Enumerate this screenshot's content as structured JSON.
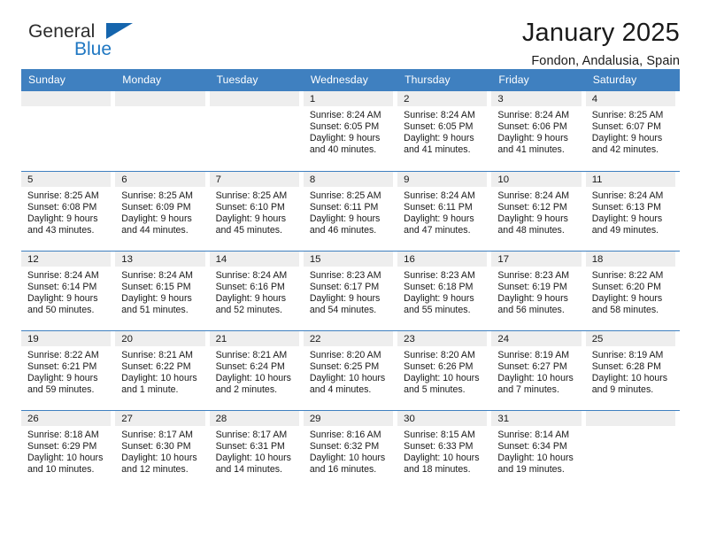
{
  "brand": {
    "word_one": "General",
    "word_two": "Blue",
    "triangle_color": "#1565ad",
    "blue_text_color": "#1f77c2"
  },
  "header": {
    "title": "January 2025",
    "subtitle": "Fondon, Andalusia, Spain",
    "header_bg": "#3f80c0",
    "header_text": "#ffffff"
  },
  "labels": {
    "sunrise_prefix": "Sunrise:",
    "sunset_prefix": "Sunset:",
    "daylight_prefix": "Daylight:"
  },
  "columns": [
    "Sunday",
    "Monday",
    "Tuesday",
    "Wednesday",
    "Thursday",
    "Friday",
    "Saturday"
  ],
  "weeks": [
    [
      {
        "day": "",
        "empty": true,
        "lines": []
      },
      {
        "day": "",
        "empty": true,
        "lines": []
      },
      {
        "day": "",
        "empty": true,
        "lines": []
      },
      {
        "day": "1",
        "empty": false,
        "lines": [
          "Sunrise: 8:24 AM",
          "Sunset: 6:05 PM",
          "Daylight: 9 hours",
          "and 40 minutes."
        ]
      },
      {
        "day": "2",
        "empty": false,
        "lines": [
          "Sunrise: 8:24 AM",
          "Sunset: 6:05 PM",
          "Daylight: 9 hours",
          "and 41 minutes."
        ]
      },
      {
        "day": "3",
        "empty": false,
        "lines": [
          "Sunrise: 8:24 AM",
          "Sunset: 6:06 PM",
          "Daylight: 9 hours",
          "and 41 minutes."
        ]
      },
      {
        "day": "4",
        "empty": false,
        "lines": [
          "Sunrise: 8:25 AM",
          "Sunset: 6:07 PM",
          "Daylight: 9 hours",
          "and 42 minutes."
        ]
      }
    ],
    [
      {
        "day": "5",
        "empty": false,
        "lines": [
          "Sunrise: 8:25 AM",
          "Sunset: 6:08 PM",
          "Daylight: 9 hours",
          "and 43 minutes."
        ]
      },
      {
        "day": "6",
        "empty": false,
        "lines": [
          "Sunrise: 8:25 AM",
          "Sunset: 6:09 PM",
          "Daylight: 9 hours",
          "and 44 minutes."
        ]
      },
      {
        "day": "7",
        "empty": false,
        "lines": [
          "Sunrise: 8:25 AM",
          "Sunset: 6:10 PM",
          "Daylight: 9 hours",
          "and 45 minutes."
        ]
      },
      {
        "day": "8",
        "empty": false,
        "lines": [
          "Sunrise: 8:25 AM",
          "Sunset: 6:11 PM",
          "Daylight: 9 hours",
          "and 46 minutes."
        ]
      },
      {
        "day": "9",
        "empty": false,
        "lines": [
          "Sunrise: 8:24 AM",
          "Sunset: 6:11 PM",
          "Daylight: 9 hours",
          "and 47 minutes."
        ]
      },
      {
        "day": "10",
        "empty": false,
        "lines": [
          "Sunrise: 8:24 AM",
          "Sunset: 6:12 PM",
          "Daylight: 9 hours",
          "and 48 minutes."
        ]
      },
      {
        "day": "11",
        "empty": false,
        "lines": [
          "Sunrise: 8:24 AM",
          "Sunset: 6:13 PM",
          "Daylight: 9 hours",
          "and 49 minutes."
        ]
      }
    ],
    [
      {
        "day": "12",
        "empty": false,
        "lines": [
          "Sunrise: 8:24 AM",
          "Sunset: 6:14 PM",
          "Daylight: 9 hours",
          "and 50 minutes."
        ]
      },
      {
        "day": "13",
        "empty": false,
        "lines": [
          "Sunrise: 8:24 AM",
          "Sunset: 6:15 PM",
          "Daylight: 9 hours",
          "and 51 minutes."
        ]
      },
      {
        "day": "14",
        "empty": false,
        "lines": [
          "Sunrise: 8:24 AM",
          "Sunset: 6:16 PM",
          "Daylight: 9 hours",
          "and 52 minutes."
        ]
      },
      {
        "day": "15",
        "empty": false,
        "lines": [
          "Sunrise: 8:23 AM",
          "Sunset: 6:17 PM",
          "Daylight: 9 hours",
          "and 54 minutes."
        ]
      },
      {
        "day": "16",
        "empty": false,
        "lines": [
          "Sunrise: 8:23 AM",
          "Sunset: 6:18 PM",
          "Daylight: 9 hours",
          "and 55 minutes."
        ]
      },
      {
        "day": "17",
        "empty": false,
        "lines": [
          "Sunrise: 8:23 AM",
          "Sunset: 6:19 PM",
          "Daylight: 9 hours",
          "and 56 minutes."
        ]
      },
      {
        "day": "18",
        "empty": false,
        "lines": [
          "Sunrise: 8:22 AM",
          "Sunset: 6:20 PM",
          "Daylight: 9 hours",
          "and 58 minutes."
        ]
      }
    ],
    [
      {
        "day": "19",
        "empty": false,
        "lines": [
          "Sunrise: 8:22 AM",
          "Sunset: 6:21 PM",
          "Daylight: 9 hours",
          "and 59 minutes."
        ]
      },
      {
        "day": "20",
        "empty": false,
        "lines": [
          "Sunrise: 8:21 AM",
          "Sunset: 6:22 PM",
          "Daylight: 10 hours",
          "and 1 minute."
        ]
      },
      {
        "day": "21",
        "empty": false,
        "lines": [
          "Sunrise: 8:21 AM",
          "Sunset: 6:24 PM",
          "Daylight: 10 hours",
          "and 2 minutes."
        ]
      },
      {
        "day": "22",
        "empty": false,
        "lines": [
          "Sunrise: 8:20 AM",
          "Sunset: 6:25 PM",
          "Daylight: 10 hours",
          "and 4 minutes."
        ]
      },
      {
        "day": "23",
        "empty": false,
        "lines": [
          "Sunrise: 8:20 AM",
          "Sunset: 6:26 PM",
          "Daylight: 10 hours",
          "and 5 minutes."
        ]
      },
      {
        "day": "24",
        "empty": false,
        "lines": [
          "Sunrise: 8:19 AM",
          "Sunset: 6:27 PM",
          "Daylight: 10 hours",
          "and 7 minutes."
        ]
      },
      {
        "day": "25",
        "empty": false,
        "lines": [
          "Sunrise: 8:19 AM",
          "Sunset: 6:28 PM",
          "Daylight: 10 hours",
          "and 9 minutes."
        ]
      }
    ],
    [
      {
        "day": "26",
        "empty": false,
        "lines": [
          "Sunrise: 8:18 AM",
          "Sunset: 6:29 PM",
          "Daylight: 10 hours",
          "and 10 minutes."
        ]
      },
      {
        "day": "27",
        "empty": false,
        "lines": [
          "Sunrise: 8:17 AM",
          "Sunset: 6:30 PM",
          "Daylight: 10 hours",
          "and 12 minutes."
        ]
      },
      {
        "day": "28",
        "empty": false,
        "lines": [
          "Sunrise: 8:17 AM",
          "Sunset: 6:31 PM",
          "Daylight: 10 hours",
          "and 14 minutes."
        ]
      },
      {
        "day": "29",
        "empty": false,
        "lines": [
          "Sunrise: 8:16 AM",
          "Sunset: 6:32 PM",
          "Daylight: 10 hours",
          "and 16 minutes."
        ]
      },
      {
        "day": "30",
        "empty": false,
        "lines": [
          "Sunrise: 8:15 AM",
          "Sunset: 6:33 PM",
          "Daylight: 10 hours",
          "and 18 minutes."
        ]
      },
      {
        "day": "31",
        "empty": false,
        "lines": [
          "Sunrise: 8:14 AM",
          "Sunset: 6:34 PM",
          "Daylight: 10 hours",
          "and 19 minutes."
        ]
      },
      {
        "day": "",
        "empty": true,
        "lines": []
      }
    ]
  ]
}
